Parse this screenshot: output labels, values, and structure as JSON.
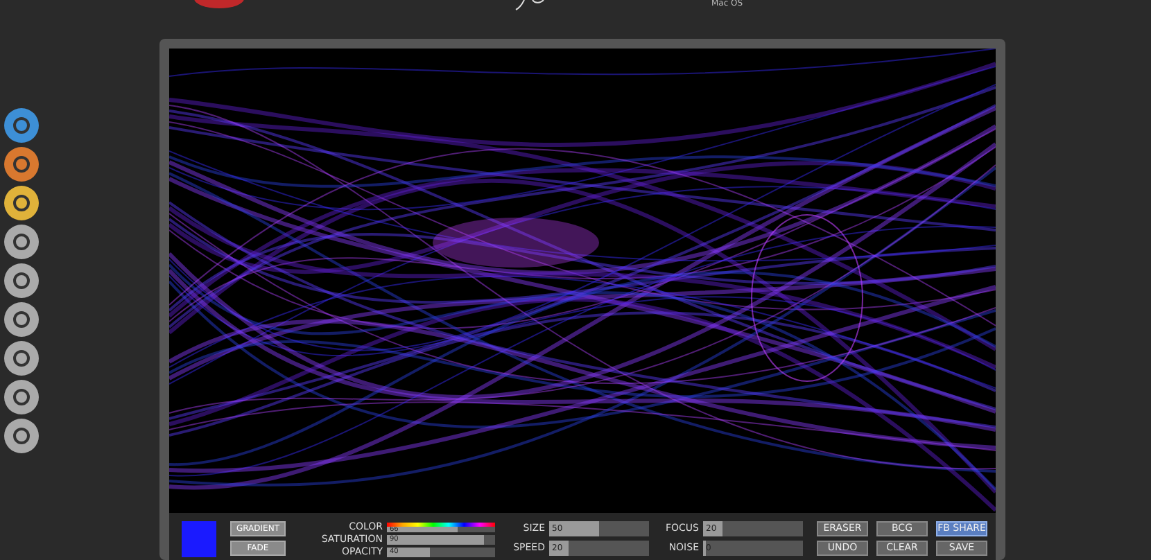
{
  "header": {
    "subtitle": "Mac OS"
  },
  "mode_buttons": [
    "GRADIENT",
    "FADE"
  ],
  "color_sliders": [
    {
      "label": "COLOR",
      "kind": "rainbow",
      "value": "66",
      "level": 0.66
    },
    {
      "label": "SATURATION",
      "kind": "plain",
      "value": "90",
      "level": 0.9
    },
    {
      "label": "OPACITY",
      "kind": "plain",
      "value": "40",
      "level": 0.4
    }
  ],
  "sliders_a": [
    {
      "label": "SIZE",
      "value": "50",
      "level": 0.5
    },
    {
      "label": "SPEED",
      "value": "20",
      "level": 0.2
    }
  ],
  "sliders_b": [
    {
      "label": "FOCUS",
      "value": "20",
      "level": 0.2
    },
    {
      "label": "NOISE",
      "value": "0",
      "level": 0
    }
  ],
  "actions": [
    {
      "label": "ERASER",
      "selected": false
    },
    {
      "label": "BCG",
      "selected": false
    },
    {
      "label": "FB SHARE",
      "selected": true
    },
    {
      "label": "UNDO",
      "selected": false
    },
    {
      "label": "CLEAR",
      "selected": false
    },
    {
      "label": "SAVE",
      "selected": false
    }
  ]
}
